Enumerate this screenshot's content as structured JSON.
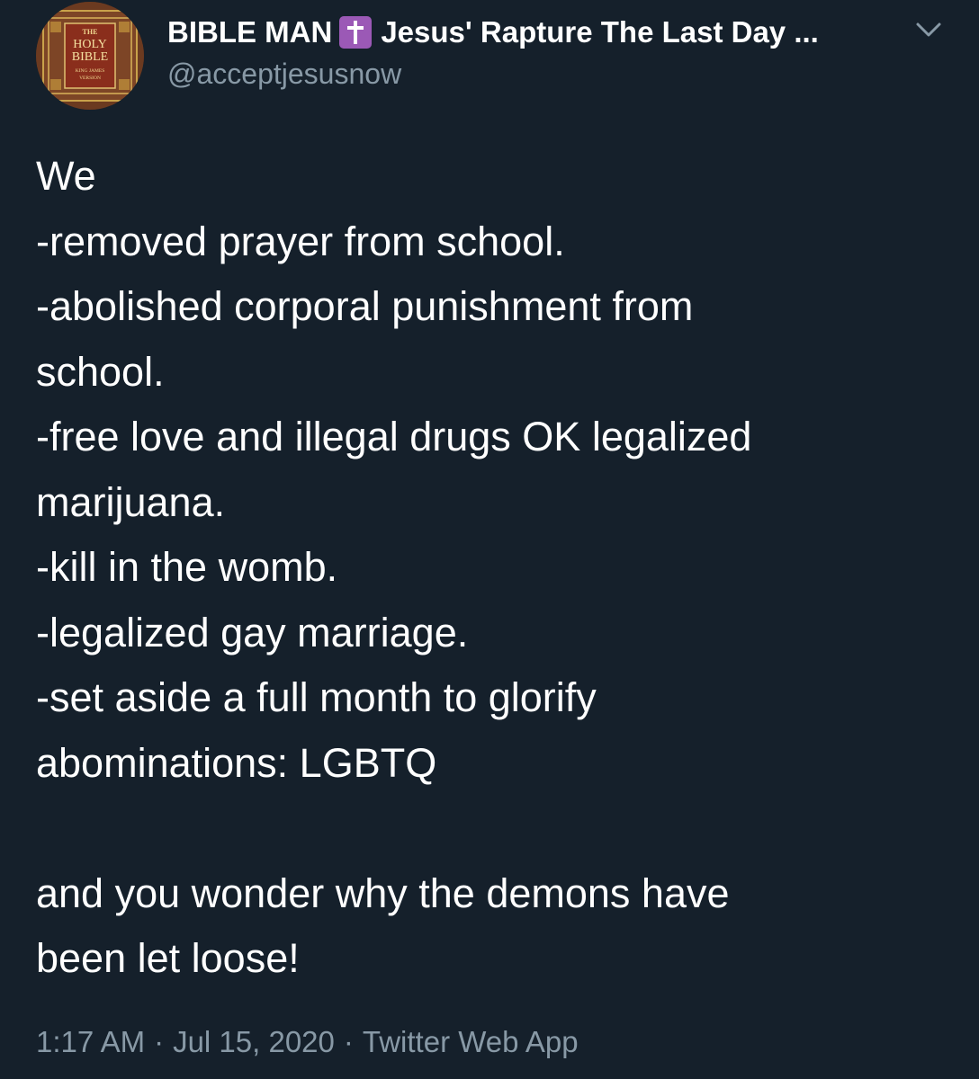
{
  "author": {
    "display_name": "BIBLE MAN",
    "badge_icon": "latin-cross-emoji",
    "display_name_suffix": "Jesus' Rapture The Last Day ...",
    "handle": "@acceptjesusnow",
    "avatar_text": {
      "line1": "THE",
      "line2": "HOLY",
      "line3": "BIBLE",
      "line4": "KING JAMES",
      "line5": "VERSION"
    }
  },
  "menu": {
    "icon": "chevron-down-icon"
  },
  "tweet": {
    "lines": [
      "We",
      "-removed prayer from school.",
      "-abolished corporal punishment from",
      "school.",
      "-free love and illegal drugs OK legalized",
      "marijuana.",
      "-kill in the womb.",
      "-legalized gay marriage.",
      "-set aside a full month to glorify",
      "abominations: LGBTQ",
      "",
      "and you wonder why the demons have",
      "been let loose!"
    ]
  },
  "meta": {
    "time": "1:17 AM",
    "separator": "·",
    "date": "Jul 15, 2020",
    "source": "Twitter Web App"
  },
  "colors": {
    "background": "#15202b",
    "text": "#ffffff",
    "secondary": "#8899a6",
    "badge": "#9b59b6"
  }
}
